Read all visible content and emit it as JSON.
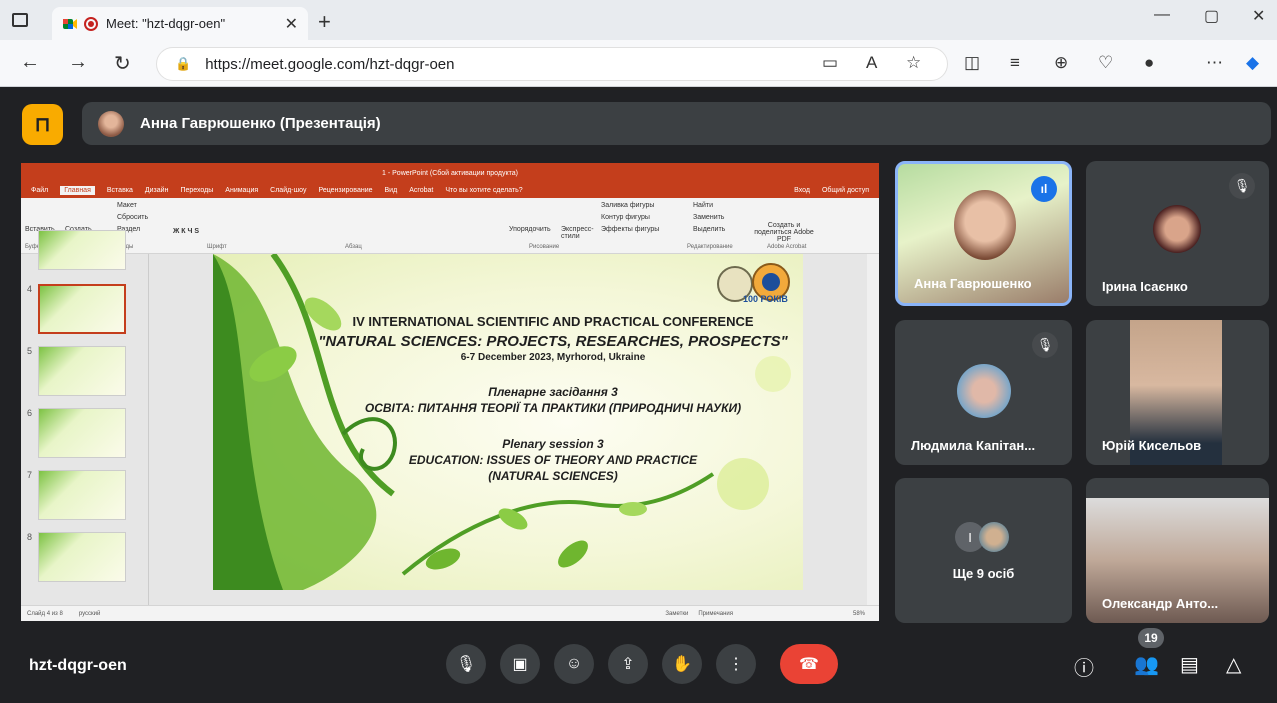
{
  "browser": {
    "tab_title": "Meet: \"hzt-dqgr-oen\"",
    "tab_close": "✕",
    "new_tab": "+",
    "url": "https://meet.google.com/hzt-dqgr-oen",
    "win_min": "—",
    "win_max": "▢",
    "win_close": "✕"
  },
  "presenter_bar": {
    "text": "Анна Гаврюшенко (Презентація)"
  },
  "powerpoint": {
    "title": "1 - PowerPoint (Сбой активации продукта)",
    "menu": [
      "Файл",
      "Главная",
      "Вставка",
      "Дизайн",
      "Переходы",
      "Анимация",
      "Слайд-шоу",
      "Рецензирование",
      "Вид",
      "Acrobat",
      "Что вы хотите сделать?"
    ],
    "signin": "Вход",
    "share": "Общий доступ",
    "ribbon_groups": [
      "Буфер обмена",
      "Слайды",
      "Шрифт",
      "Абзац",
      "Рисование",
      "Редактирование",
      "Adobe Acrobat"
    ],
    "ribbon_buttons": {
      "paste": "Вставить",
      "create_slide": "Создать слайд",
      "layout": "Макет",
      "reset": "Сбросить",
      "section": "Раздел",
      "arrange": "Упорядочить",
      "express": "Экспресс-стили",
      "fill": "Заливка фигуры",
      "outline": "Контур фигуры",
      "effects": "Эффекты фигуры",
      "find": "Найти",
      "replace": "Заменить",
      "select": "Выделить",
      "create_pdf": "Создать и поделиться Adobe PDF"
    },
    "thumb_numbers": [
      "4",
      "5",
      "6",
      "7",
      "8"
    ],
    "status": "Слайд 4 из 8",
    "status_lang": "русский",
    "notes": "Заметки",
    "comments": "Примечания",
    "zoom": "58%"
  },
  "slide": {
    "line1": "IV INTERNATIONAL SCIENTIFIC AND PRACTICAL CONFERENCE",
    "line2": "\"NATURAL SCIENCES: PROJECTS, RESEARCHES, PROSPECTS\"",
    "line3": "6-7 December 2023, Myrhorod, Ukraine",
    "line4": "Пленарне засідання 3",
    "line5": "ОСВІТА: ПИТАННЯ ТЕОРІЇ ТА ПРАКТИКИ (ПРИРОДНИЧІ НАУКИ)",
    "line6": "Plenary session 3",
    "line7": "EDUCATION: ISSUES OF THEORY AND PRACTICE",
    "line8": "(NATURAL SCIENCES)",
    "logo_text": "100 РОКІВ"
  },
  "participants": [
    {
      "name": "Анна Гаврюшенко"
    },
    {
      "name": "Ірина Ісаєнко"
    },
    {
      "name": "Людмила Капітан..."
    },
    {
      "name": "Юрій Кисельов"
    },
    {
      "name": "Ще 9 осіб",
      "initial": "І"
    },
    {
      "name": "Олександр Анто..."
    }
  ],
  "bottom": {
    "meeting_code": "hzt-dqgr-oen",
    "people_count": "19"
  },
  "colors": {
    "meet_bg": "#202124",
    "tile_bg": "#3c4043",
    "exit_button": "#f9ab00",
    "end_call": "#ea4335",
    "active_speaker": "#8ab4f8",
    "powerpoint_accent": "#c43e1c"
  }
}
